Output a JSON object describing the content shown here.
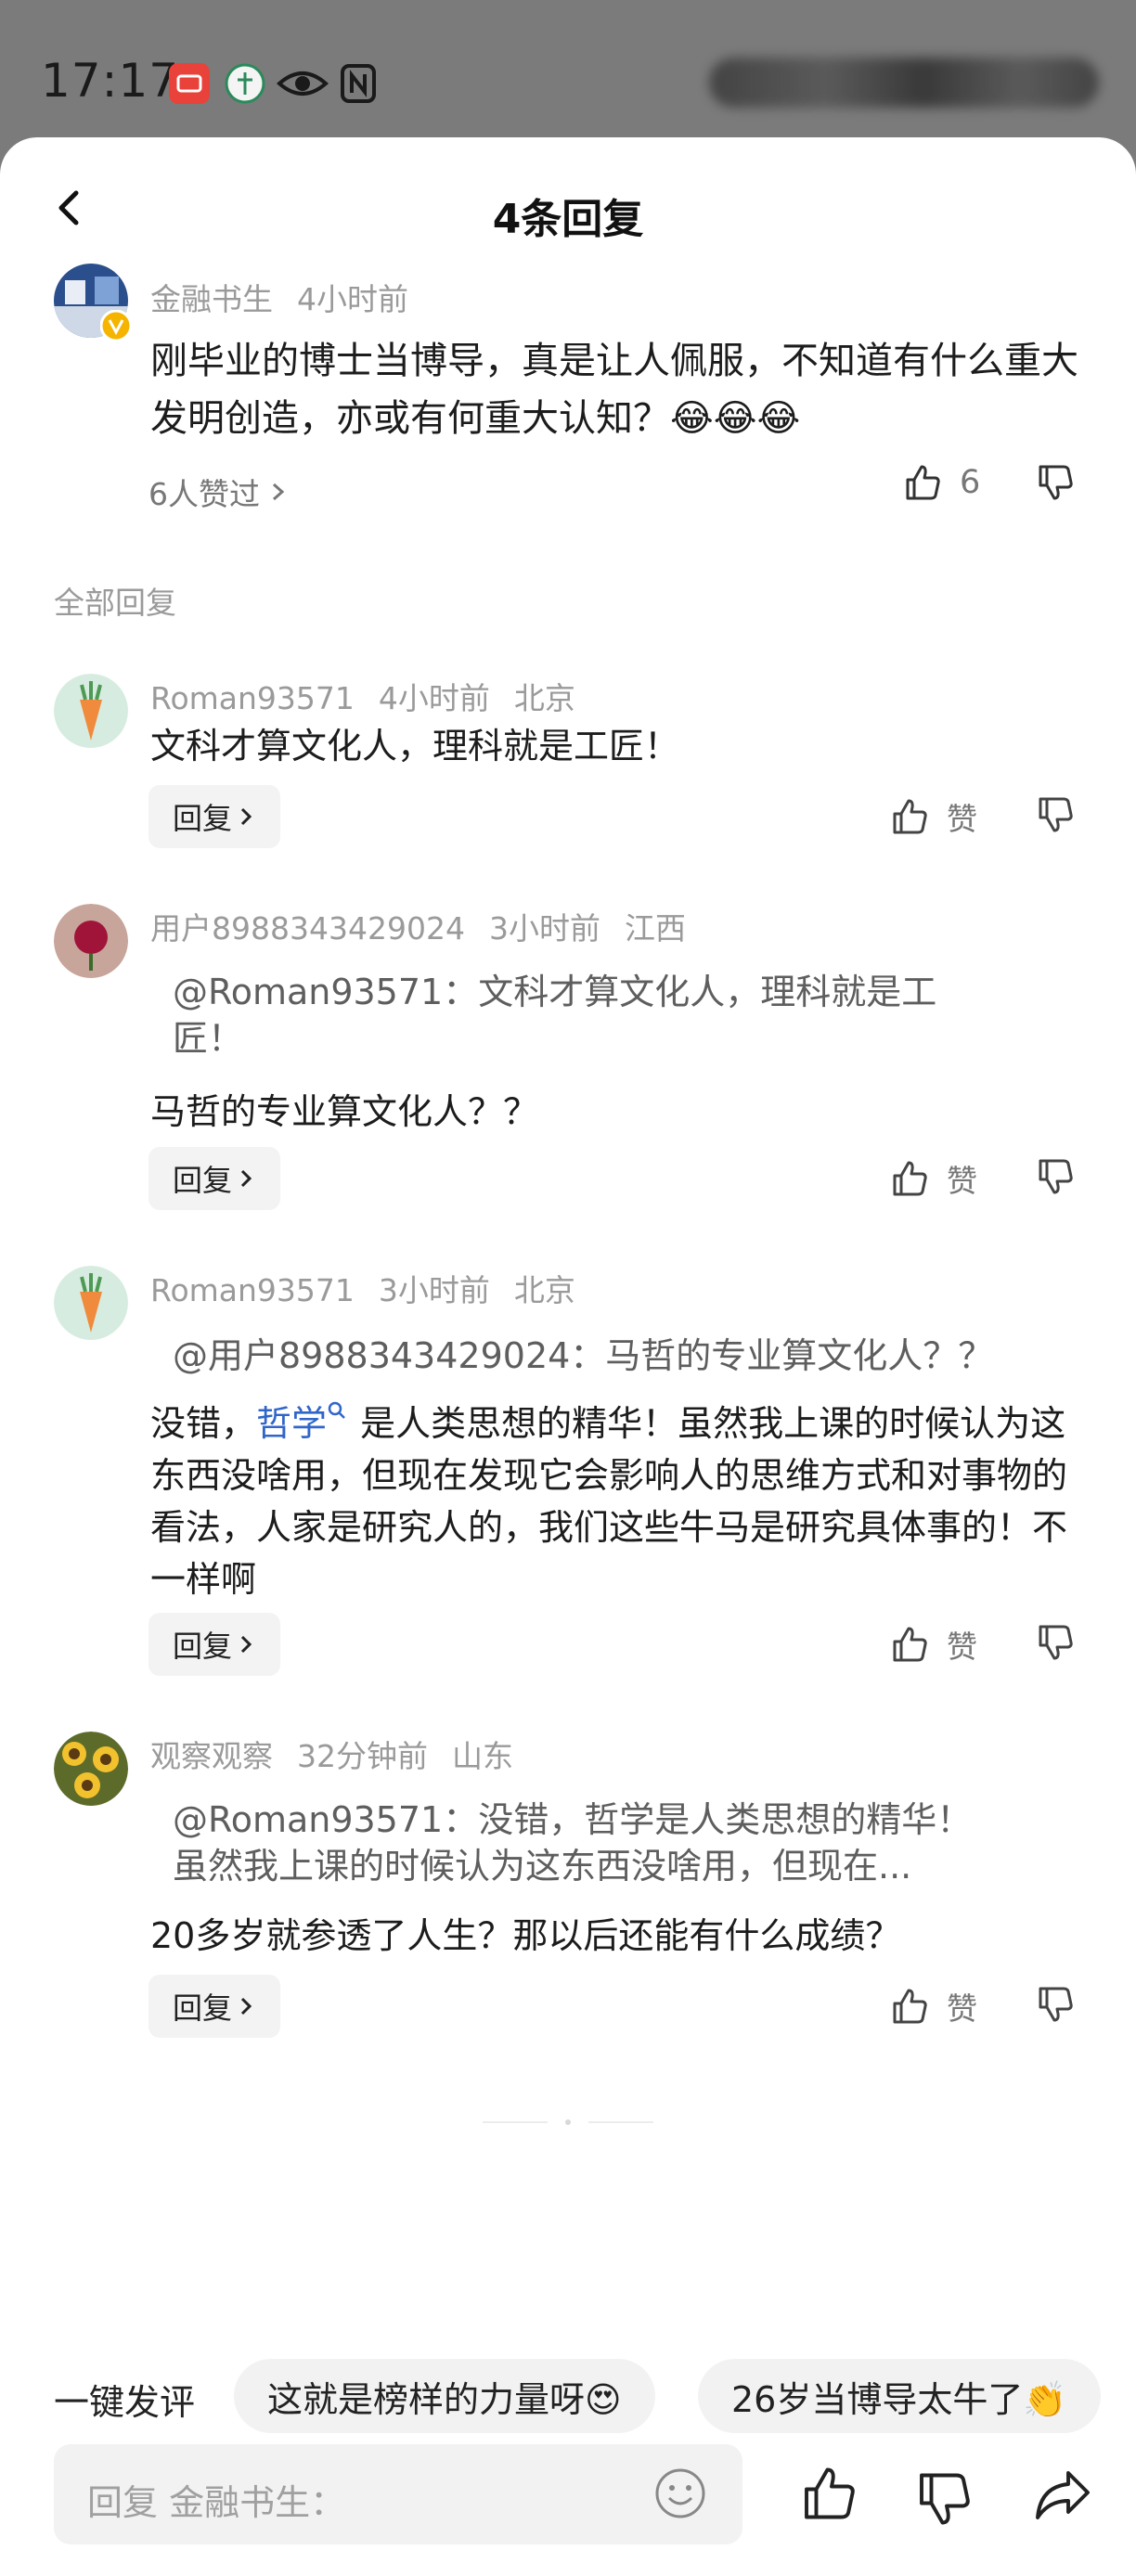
{
  "status_bar": {
    "time": "17:17"
  },
  "header": {
    "title": "4条回复"
  },
  "root_comment": {
    "author": "金融书生",
    "time": "4小时前",
    "text": "刚毕业的博士当博导，真是让人佩服，不知道有什么重大发明创造，亦或有何重大认知？😂😂😂",
    "likers": "6人赞过",
    "like_count": "6"
  },
  "section_label": "全部回复",
  "replies": [
    {
      "author": "Roman93571",
      "time": "4小时前",
      "location": "北京",
      "quote_line1": "",
      "quote_line2": "",
      "text": "文科才算文化人，理科就是工匠！",
      "reply_label": "回复",
      "like_label": "赞"
    },
    {
      "author": "用户8988343429024",
      "time": "3小时前",
      "location": "江西",
      "quote_line1": "@Roman93571：文科才算文化人，理科就是工",
      "quote_line2": "匠！",
      "text": "马哲的专业算文化人？？",
      "reply_label": "回复",
      "like_label": "赞"
    },
    {
      "author": "Roman93571",
      "time": "3小时前",
      "location": "北京",
      "quote_line1": "@用户8988343429024：马哲的专业算文化人？？",
      "quote_line2": "",
      "text_pre": "没错，",
      "text_link": "哲学",
      "text_post": " 是人类思想的精华！虽然我上课的时候认为这东西没啥用，但现在发现它会影响人的思维方式和对事物的看法，人家是研究人的，我们这些牛马是研究具体事的！不一样啊",
      "reply_label": "回复",
      "like_label": "赞"
    },
    {
      "author": "观察观察",
      "time": "32分钟前",
      "location": "山东",
      "quote_line1": "@Roman93571：没错，哲学是人类思想的精华！",
      "quote_line2": "虽然我上课的时候认为这东西没啥用，但现在...",
      "text": "20多岁就参透了人生？那以后还能有什么成绩？",
      "reply_label": "回复",
      "like_label": "赞"
    }
  ],
  "quick_comments": {
    "label": "一键发评",
    "chips": [
      "这就是榜样的力量呀😍",
      "26岁当博导太牛了👏"
    ]
  },
  "input": {
    "placeholder": "回复 金融书生："
  },
  "colors": {
    "link": "#2f66c9",
    "meta": "#9a9a9a",
    "sheet": "#ffffff",
    "backdrop": "#7b7b7b"
  }
}
